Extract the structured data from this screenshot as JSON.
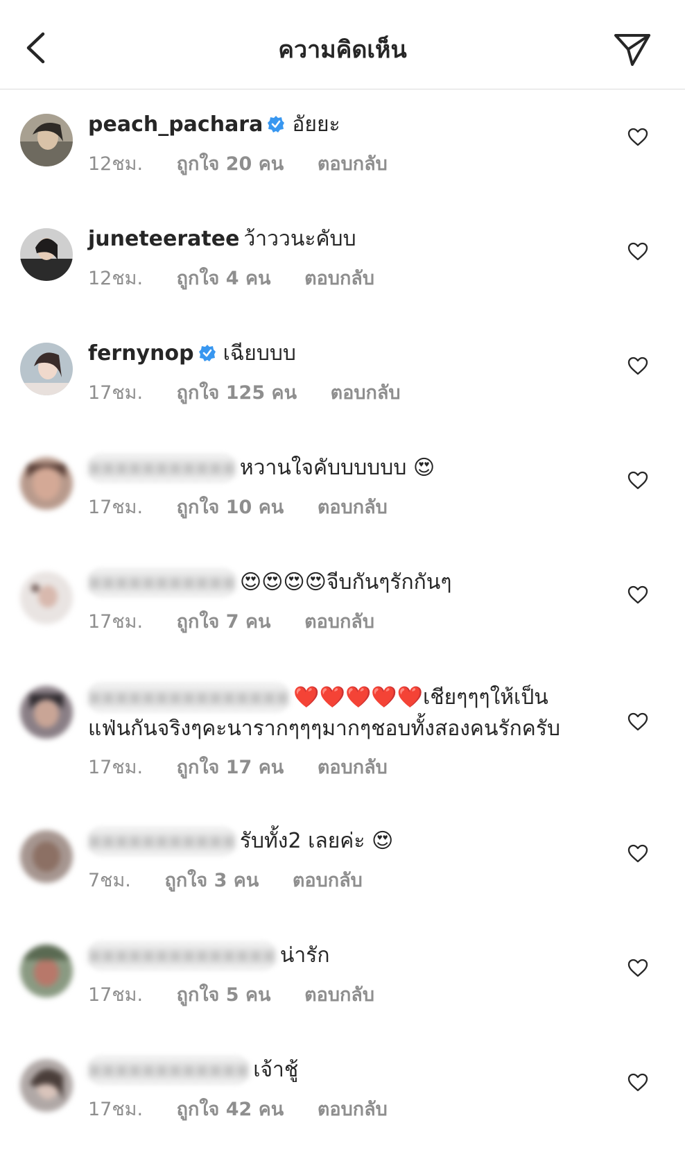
{
  "header": {
    "title": "ความคิดเห็น"
  },
  "comments": [
    {
      "username": "peach_pachara",
      "verified": true,
      "text": "อัยยะ",
      "time": "12ชม.",
      "likes": "ถูกใจ 20 คน",
      "reply": "ตอบกลับ"
    },
    {
      "username": "juneteeratee",
      "verified": false,
      "text": "ว้าววนะคับบ",
      "time": "12ชม.",
      "likes": "ถูกใจ 4 คน",
      "reply": "ตอบกลับ"
    },
    {
      "username": "fernynop",
      "verified": true,
      "text": "เฉียบบบ",
      "time": "17ชม.",
      "likes": "ถูกใจ 125 คน",
      "reply": "ตอบกลับ"
    },
    {
      "username": "",
      "verified": false,
      "text": "หวานใจคับบบบบบ 😍",
      "time": "17ชม.",
      "likes": "ถูกใจ 10 คน",
      "reply": "ตอบกลับ"
    },
    {
      "username": "",
      "verified": false,
      "text": "😍😍😍😍จีบกันๆรักกันๆ",
      "time": "17ชม.",
      "likes": "ถูกใจ 7 คน",
      "reply": "ตอบกลับ"
    },
    {
      "username": "",
      "verified": false,
      "text": "❤️❤️❤️❤️❤️เชียๆๆๆให้เป็นแฟ่นกันจริงๆคะนารากๆๆๆมากๆชอบทั้งสองคนรักครับ",
      "time": "17ชม.",
      "likes": "ถูกใจ 17 คน",
      "reply": "ตอบกลับ"
    },
    {
      "username": "",
      "verified": false,
      "text": "รับทั้ง2 เลยค่ะ 😍",
      "time": "7ชม.",
      "likes": "ถูกใจ 3 คน",
      "reply": "ตอบกลับ"
    },
    {
      "username": "",
      "verified": false,
      "text": "น่ารัก",
      "time": "17ชม.",
      "likes": "ถูกใจ 5 คน",
      "reply": "ตอบกลับ"
    },
    {
      "username": "",
      "verified": false,
      "text": "เจ้าชู้",
      "time": "17ชม.",
      "likes": "ถูกใจ 42 คน",
      "reply": "ตอบกลับ"
    }
  ],
  "colors": {
    "verified": "#3897f0",
    "meta": "#8e8e8e",
    "text": "#262626"
  },
  "icons": {
    "back": "chevron-left-icon",
    "send": "paper-plane-icon",
    "like": "heart-outline-icon",
    "verified": "verified-badge-icon"
  }
}
